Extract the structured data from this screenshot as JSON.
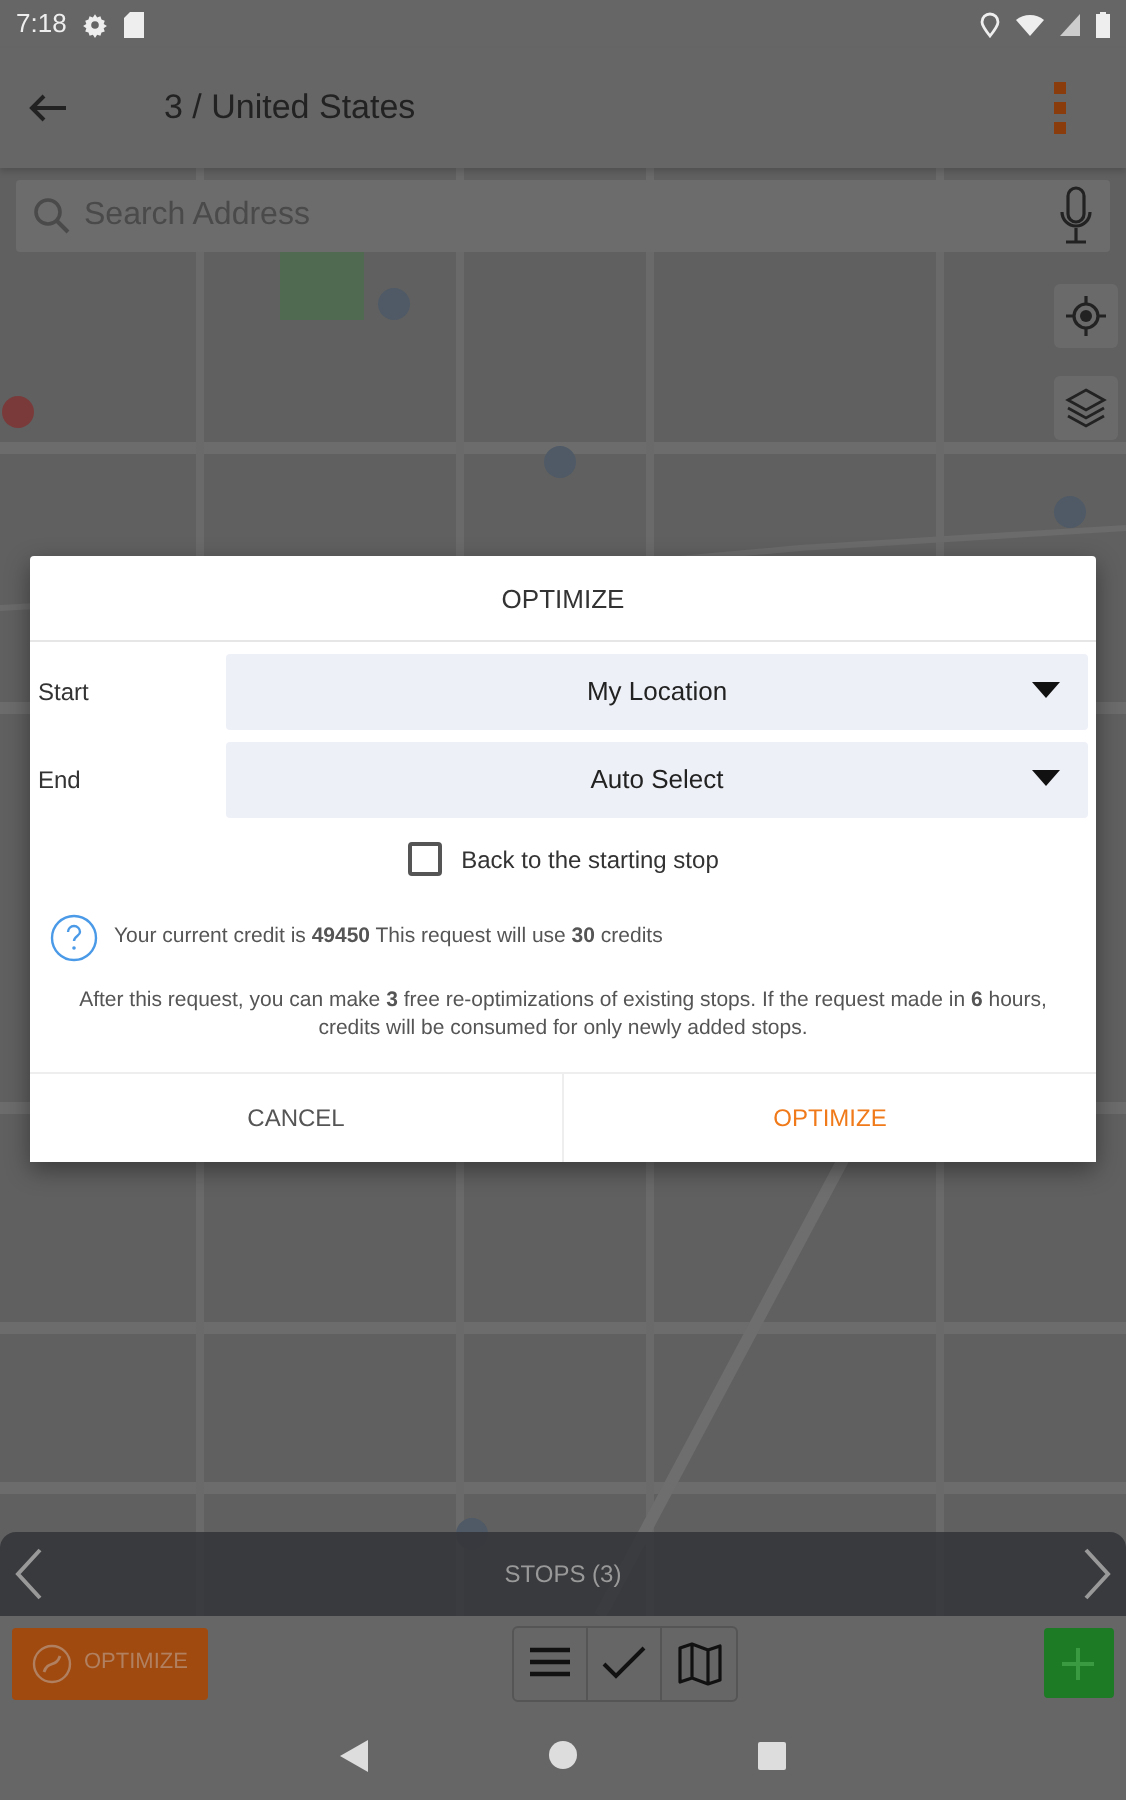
{
  "status_bar": {
    "time": "7:18"
  },
  "app_bar": {
    "title": "3 / United States"
  },
  "search": {
    "placeholder": "Search Address"
  },
  "stops_bar": {
    "label": "STOPS (3)"
  },
  "toolbar": {
    "optimize_label": "OPTIMIZE",
    "views": [
      {
        "kind": "list"
      },
      {
        "kind": "check"
      },
      {
        "kind": "map"
      }
    ]
  },
  "dialog": {
    "title": "OPTIMIZE",
    "fields": [
      {
        "label": "Start",
        "value": "My Location"
      },
      {
        "label": "End",
        "value": "Auto Select"
      }
    ],
    "checkbox": {
      "label": "Back to the starting stop",
      "checked": false
    },
    "credit_note": "Your current credit is **49450** This request will use **30** credits",
    "info": "After this request, you can make **3** free re-optimizations of existing stops. If the request made in **6** hours, credits will be consumed for only newly added stops.",
    "buttons": [
      {
        "label": "CANCEL",
        "kind": "cancel"
      },
      {
        "label": "OPTIMIZE",
        "kind": "primary"
      }
    ]
  }
}
